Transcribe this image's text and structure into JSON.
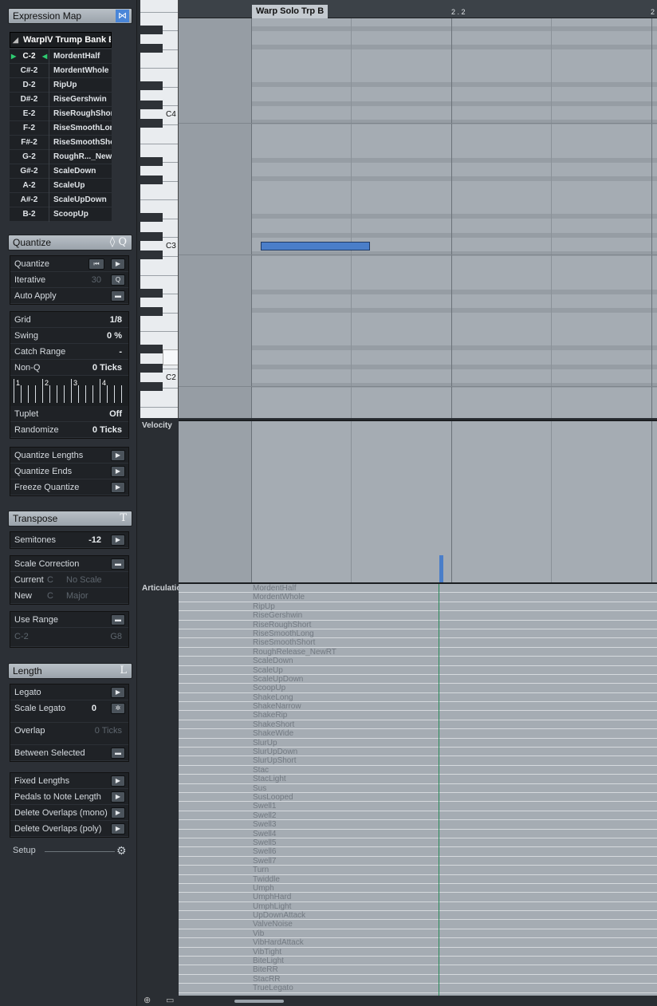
{
  "expression_map": {
    "title": "Expression Map",
    "map_name": "WarpIV Trump Bank E",
    "rows": [
      {
        "key": "C-2",
        "art": "MordentHalf"
      },
      {
        "key": "C#-2",
        "art": "MordentWhole"
      },
      {
        "key": "D-2",
        "art": "RipUp"
      },
      {
        "key": "D#-2",
        "art": "RiseGershwin"
      },
      {
        "key": "E-2",
        "art": "RiseRoughShor"
      },
      {
        "key": "F-2",
        "art": "RiseSmoothLon"
      },
      {
        "key": "F#-2",
        "art": "RiseSmoothSho"
      },
      {
        "key": "G-2",
        "art": "RoughR..._New"
      },
      {
        "key": "G#-2",
        "art": "ScaleDown"
      },
      {
        "key": "A-2",
        "art": "ScaleUp"
      },
      {
        "key": "A#-2",
        "art": "ScaleUpDown"
      },
      {
        "key": "B-2",
        "art": "ScoopUp"
      }
    ]
  },
  "quantize": {
    "title": "Quantize",
    "quantize_label": "Quantize",
    "iterative_label": "Iterative",
    "iterative_value": "30",
    "auto_apply_label": "Auto Apply",
    "grid_label": "Grid",
    "grid_value": "1/8",
    "swing_label": "Swing",
    "swing_value": "0 %",
    "catch_label": "Catch Range",
    "catch_value": "-",
    "nonq_label": "Non-Q",
    "nonq_value": "0 Ticks",
    "beats": [
      "1",
      "2",
      "3",
      "4"
    ],
    "tuplet_label": "Tuplet",
    "tuplet_value": "Off",
    "randomize_label": "Randomize",
    "randomize_value": "0 Ticks",
    "qlengths_label": "Quantize Lengths",
    "qends_label": "Quantize Ends",
    "freeze_label": "Freeze Quantize"
  },
  "transpose": {
    "title": "Transpose",
    "semitones_label": "Semitones",
    "semitones_value": "-12",
    "scale_correction_label": "Scale Correction",
    "current_label": "Current",
    "current_root": "C",
    "current_scale": "No Scale",
    "new_label": "New",
    "new_root": "C",
    "new_scale": "Major",
    "use_range_label": "Use Range",
    "range_low": "C-2",
    "range_high": "G8"
  },
  "length": {
    "title": "Length",
    "legato_label": "Legato",
    "scale_legato_label": "Scale Legato",
    "scale_legato_value": "0",
    "overlap_label": "Overlap",
    "overlap_value": "0 Ticks",
    "between_label": "Between Selected",
    "fixed_label": "Fixed Lengths",
    "pedals_label": "Pedals to Note Length",
    "mono_label": "Delete Overlaps (mono)",
    "poly_label": "Delete Overlaps (poly)",
    "setup_label": "Setup"
  },
  "editor": {
    "part_name": "Warp Solo Trp B",
    "ruler_mark1": "2 . 2",
    "ruler_mark2": "2",
    "octave_labels": [
      "C4",
      "C3",
      "C2"
    ],
    "velocity_label": "Velocity",
    "articulation_label": "Articulations",
    "articulations": [
      "MordentHalf",
      "MordentWhole",
      "RipUp",
      "RiseGershwin",
      "RiseRoughShort",
      "RiseSmoothLong",
      "RiseSmoothShort",
      "RoughRelease_NewRT",
      "ScaleDown",
      "ScaleUp",
      "ScaleUpDown",
      "ScoopUp",
      "ShakeLong",
      "ShakeNarrow",
      "ShakeRip",
      "ShakeShort",
      "ShakeWide",
      "SlurUp",
      "SlurUpDown",
      "SlurUpShort",
      "Stac",
      "StacLight",
      "Sus",
      "SusLooped",
      "Swell1",
      "Swell2",
      "Swell3",
      "Swell4",
      "Swell5",
      "Swell6",
      "Swell7",
      "Turn",
      "Twiddle",
      "Umph",
      "UmphHard",
      "UmphLight",
      "UpDownAttack",
      "ValveNoise",
      "Vib",
      "VibHardAttack",
      "VibTight",
      "BiteLight",
      "BiteRR",
      "StacRR",
      "TrueLegato"
    ]
  }
}
